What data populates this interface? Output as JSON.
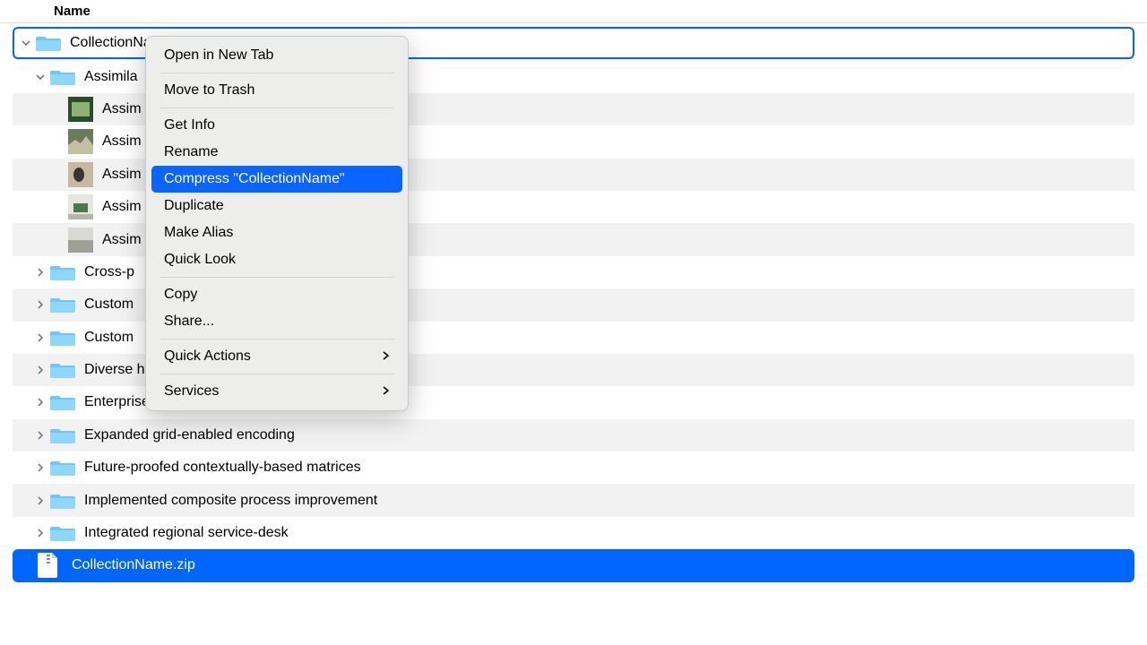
{
  "header": {
    "name_col": "Name"
  },
  "root": {
    "name": "CollectionName"
  },
  "expanded_folder": {
    "name": "Assimila"
  },
  "files_trunc": [
    "Assim",
    "Assim",
    "Assim",
    "Assim",
    "Assim"
  ],
  "folders": [
    "Cross-p",
    "Custom",
    "Custom",
    "Diverse hybrid capacity",
    "Enterprise-wide web-enabled synergy",
    "Expanded grid-enabled encoding",
    "Future-proofed contextually-based matrices",
    "Implemented composite process improvement",
    "Integrated regional service-desk"
  ],
  "zip": {
    "name": "CollectionName.zip"
  },
  "menu": {
    "open_new_tab": "Open in New Tab",
    "move_trash": "Move to Trash",
    "get_info": "Get Info",
    "rename": "Rename",
    "compress": "Compress \"CollectionName\"",
    "duplicate": "Duplicate",
    "make_alias": "Make Alias",
    "quick_look": "Quick Look",
    "copy": "Copy",
    "share": "Share...",
    "quick_actions": "Quick Actions",
    "services": "Services"
  },
  "thumbs": [
    {
      "bg": "#2d4a2d",
      "accent": "#8fb36d"
    },
    {
      "bg": "#6b7a5c",
      "accent": "#c2c0a0"
    },
    {
      "bg": "#3a352f",
      "accent": "#c5b9a4"
    },
    {
      "bg": "#e6e6e0",
      "accent": "#4a7a4a"
    },
    {
      "bg": "#d8d8d4",
      "accent": "#a0a098"
    }
  ]
}
